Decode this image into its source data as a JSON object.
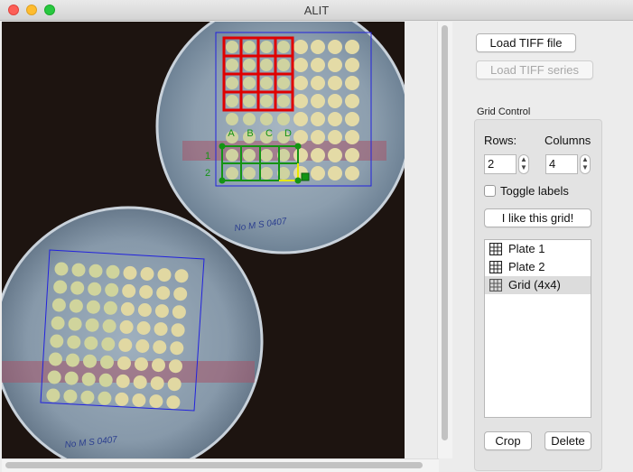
{
  "window": {
    "title": "ALIT"
  },
  "canvas": {
    "plate1_labels": {
      "columns": [
        "A",
        "B",
        "C",
        "D"
      ],
      "rows": [
        "1",
        "2"
      ]
    },
    "handwriting": {
      "plate1": "No M S 0407",
      "plate2": "No M S 0407"
    }
  },
  "controls": {
    "load_tiff_file": "Load TIFF file",
    "load_tiff_series": "Load TIFF series",
    "grid_control_label": "Grid Control",
    "rows_label": "Rows:",
    "columns_label": "Columns",
    "rows_value": "2",
    "columns_value": "4",
    "toggle_labels": "Toggle labels",
    "like_grid": "I like this grid!",
    "crop": "Crop",
    "delete": "Delete"
  },
  "list": {
    "items": [
      {
        "label": "Plate 1",
        "icon": "grid-icon"
      },
      {
        "label": "Plate 2",
        "icon": "grid-icon"
      },
      {
        "label": "Grid  (4x4)",
        "icon": "grid-icon",
        "selected": true
      }
    ]
  }
}
